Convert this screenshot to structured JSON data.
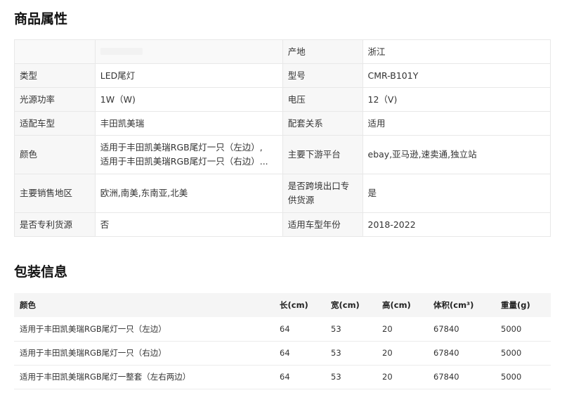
{
  "attributes_section": {
    "title": "商品属性",
    "rows": [
      {
        "k1": "",
        "v1": "",
        "k2": "产地",
        "v2": "浙江"
      },
      {
        "k1": "类型",
        "v1": "LED尾灯",
        "k2": "型号",
        "v2": "CMR-B101Y"
      },
      {
        "k1": "光源功率",
        "v1": "1W（W)",
        "k2": "电压",
        "v2": "12（V)"
      },
      {
        "k1": "适配车型",
        "v1": "丰田凯美瑞",
        "k2": "配套关系",
        "v2": "适用"
      },
      {
        "k1": "颜色",
        "v1_line1": "适用于丰田凯美瑞RGB尾灯一只（左边）,",
        "v1_line2": "适用于丰田凯美瑞RGB尾灯一只（右边）...",
        "k2": "主要下游平台",
        "v2": "ebay,亚马逊,速卖通,独立站"
      },
      {
        "k1": "主要销售地区",
        "v1": "欧洲,南美,东南亚,北美",
        "k2_line1": "是否跨境出口专",
        "k2_line2": "供货源",
        "v2": "是"
      },
      {
        "k1": "是否专利货源",
        "v1": "否",
        "k2": "适用车型年份",
        "v2": "2018-2022"
      }
    ]
  },
  "packaging_section": {
    "title": "包装信息",
    "headers": [
      "颜色",
      "长(cm)",
      "宽(cm)",
      "高(cm)",
      "体积(cm³)",
      "重量(g)"
    ],
    "rows": [
      [
        "适用于丰田凯美瑞RGB尾灯一只（左边）",
        "64",
        "53",
        "20",
        "67840",
        "5000"
      ],
      [
        "适用于丰田凯美瑞RGB尾灯一只（右边）",
        "64",
        "53",
        "20",
        "67840",
        "5000"
      ],
      [
        "适用于丰田凯美瑞RGB尾灯一整套（左右两边）",
        "64",
        "53",
        "20",
        "67840",
        "5000"
      ]
    ]
  }
}
